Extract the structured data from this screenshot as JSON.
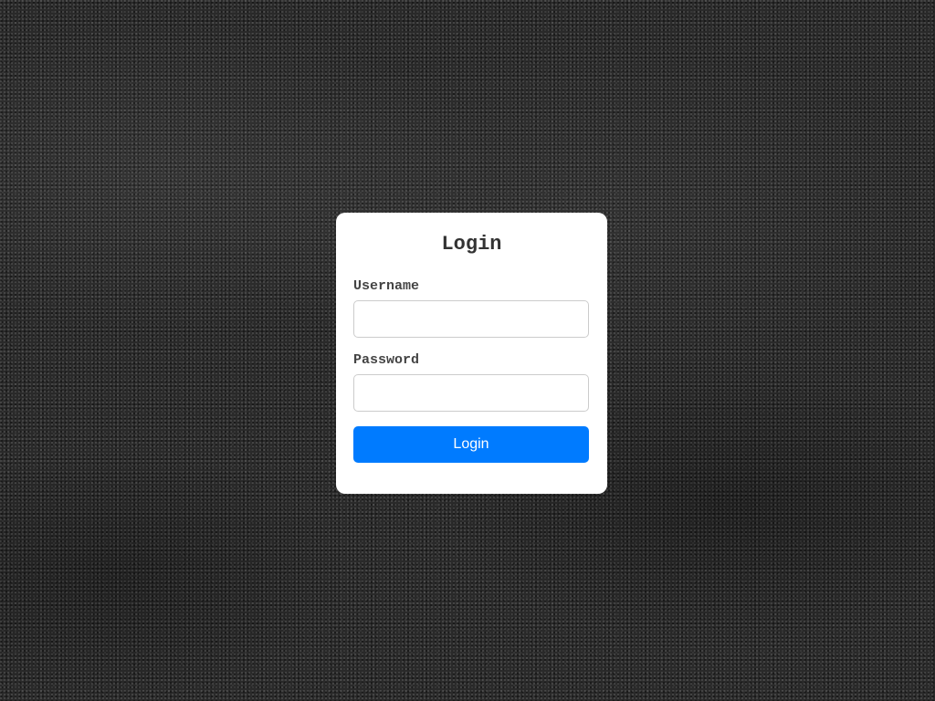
{
  "background": {
    "description_icon": "dark-sand-texture",
    "base_color": "#2a2a2a"
  },
  "login_card": {
    "title": "Login",
    "username": {
      "label": "Username",
      "value": "",
      "placeholder": ""
    },
    "password": {
      "label": "Password",
      "value": "",
      "placeholder": ""
    },
    "submit_label": "Login"
  },
  "colors": {
    "card_background": "#ffffff",
    "button_background": "#007bff",
    "button_text": "#ffffff",
    "title_text": "#333333",
    "label_text": "#444444",
    "input_border": "#cccccc"
  }
}
